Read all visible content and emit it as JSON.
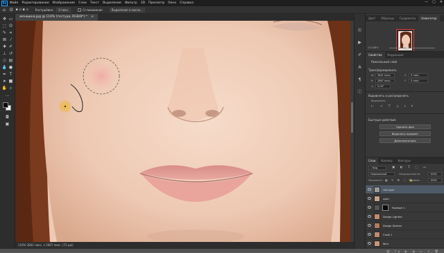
{
  "app": {
    "logo": "Ps"
  },
  "menu": [
    "Файл",
    "Редактирование",
    "Изображение",
    "Слои",
    "Текст",
    "Выделение",
    "Фильтр",
    "3D",
    "Просмотр",
    "Окно",
    "Справка"
  ],
  "window_controls": {
    "minimize": "—",
    "maximize": "▢",
    "close": "✕"
  },
  "options_bar": {
    "tolerance_label": "Растушёвка:",
    "tolerance_value": "0 пикс.",
    "antialias_label": "Сглаживание",
    "select_mask_label": "Выделение и маска..."
  },
  "document_tab": {
    "title": "женщина.jpg @ 116% (тестура, RGB/8*) *",
    "close": "×"
  },
  "status_bar": {
    "text": "116% 3841 пикс. x 2667 пикс. (72 ppi)"
  },
  "tools": [
    "move-icon",
    "marquee-icon",
    "lasso-icon",
    "quick-select-icon",
    "crop-icon",
    "frame-icon",
    "eyedropper-icon",
    "healing-icon",
    "brush-icon",
    "stamp-icon",
    "history-brush-icon",
    "eraser-icon",
    "gradient-icon",
    "blur-icon",
    "dodge-icon",
    "pen-icon",
    "type-icon",
    "path-select-icon",
    "shape-icon",
    "hand-icon",
    "zoom-icon",
    "more-icon"
  ],
  "colors": {
    "foreground": "#0a0a0a",
    "background": "#f2f2f2",
    "brush_cursor": "#e8b020",
    "selection_accent": "#4f5a68"
  },
  "navigator": {
    "tabs": [
      "Цвет",
      "Образцы",
      "Градиенты",
      "Навигатор"
    ],
    "active_tab": "Навигатор",
    "zoom": "115,88%"
  },
  "properties": {
    "tabs": [
      "Свойства",
      "Коррекция"
    ],
    "layer_kind": "Пиксельный слой",
    "transform_title": "Трансформировать",
    "w": "3841 пикс.",
    "h": "2667 пикс.",
    "x": "0 пикс.",
    "y": "0 пикс.",
    "angle": "0,00°",
    "align_title": "Выровнять и распределить",
    "align_label": "Выровнять:",
    "quick_actions_title": "Быстрые действия",
    "actions": [
      "Удалить фон",
      "Выделить предмет",
      "Дополнительно"
    ]
  },
  "layers": {
    "tabs": [
      "Слои",
      "Каналы",
      "Контуры"
    ],
    "kind_label": "Вид",
    "blend_mode": "Нормальный",
    "opacity_label": "Непрозрачность:",
    "opacity_value": "100%",
    "lock_label": "Закрепить:",
    "fill_label": "Заливка:",
    "fill_value": "100%",
    "items": [
      {
        "name": "тестура",
        "selected": true
      },
      {
        "name": "цвет",
        "selected": false
      },
      {
        "name": "Кривые 1",
        "selected": false
      },
      {
        "name": "Dodge Lighten",
        "selected": false
      },
      {
        "name": "Dodge Darken",
        "selected": false
      },
      {
        "name": "Слой 1",
        "selected": false
      },
      {
        "name": "Фон",
        "selected": false
      }
    ]
  }
}
